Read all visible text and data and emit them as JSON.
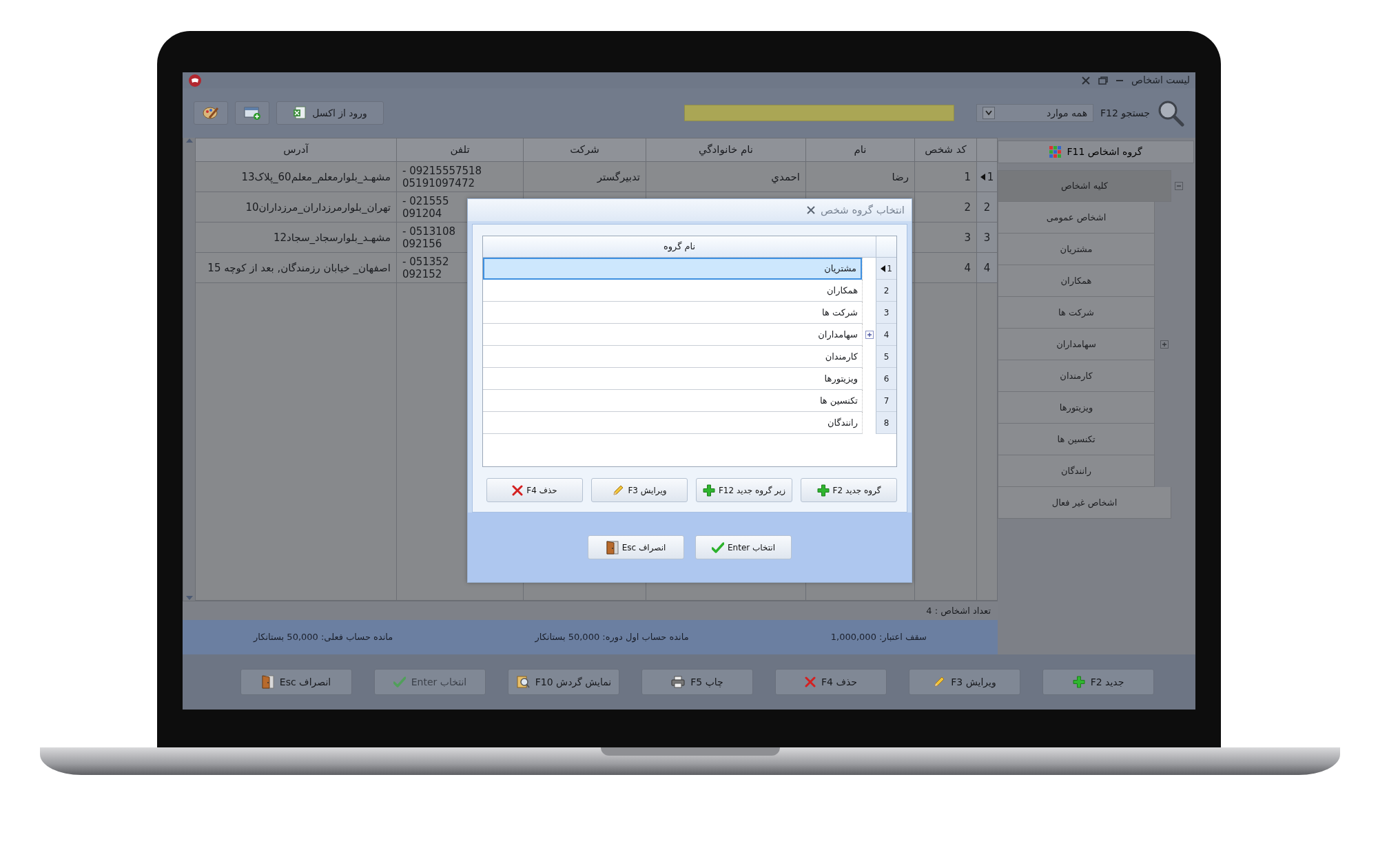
{
  "window": {
    "title": "لیست اشخاص"
  },
  "toolbar": {
    "import_button": "ورود از اکسل",
    "search_label": "جستجو F12",
    "search_scope": "همه موارد"
  },
  "table": {
    "columns": [
      "کد شخص",
      "نام",
      "نام خانوادگي",
      "شرکت",
      "تلفن",
      "آدرس"
    ],
    "rows": [
      {
        "indicator": "1",
        "selected": true,
        "cells": [
          "1",
          "رضا",
          "احمدي",
          "تدبیرگستر",
          "09215557518 -\n05191097472",
          "مشهـد_بلوارمعلم_معلم60_پلاک13"
        ]
      },
      {
        "indicator": "2",
        "selected": false,
        "cells": [
          "2",
          null,
          null,
          null,
          "021555 -\n091204",
          "تهران_بلوارمرزداران_مرزداران10"
        ]
      },
      {
        "indicator": "3",
        "selected": false,
        "cells": [
          "3",
          null,
          null,
          null,
          "0513108 -\n092156",
          "مشهـد_بلوارسجاد_سجاد12"
        ]
      },
      {
        "indicator": "4",
        "selected": false,
        "cells": [
          "4",
          null,
          null,
          null,
          "051352 -\n092152",
          "اصفهان_ خیابان رزمندگان, بعد از کوچه 15"
        ]
      }
    ]
  },
  "status": {
    "count": "تعداد اشخاص : 4"
  },
  "info_bar": [
    "سقف اعتبار: 1,000,000",
    "مانده حساب اول دوره: 50,000 بستانکار",
    "مانده حساب فعلی: 50,000 بستانکار"
  ],
  "sidebar": {
    "header": "گروه اشخاص F11",
    "items": [
      {
        "label": "کلیه اشخاص",
        "selected": true,
        "expanded": true,
        "children": [
          {
            "label": "اشخاص عمومی",
            "selected": false
          },
          {
            "label": "مشتریان",
            "selected": false
          },
          {
            "label": "همکاران",
            "selected": false
          },
          {
            "label": "شرکت ها",
            "selected": false
          },
          {
            "label": "سهامداران",
            "selected": false,
            "expanded": false
          },
          {
            "label": "کارمندان",
            "selected": false
          },
          {
            "label": "ویزیتورها",
            "selected": false
          },
          {
            "label": "تکنسین ها",
            "selected": false
          },
          {
            "label": "رانندگان",
            "selected": false
          }
        ]
      },
      {
        "label": "اشخاص غیر فعال",
        "selected": false
      }
    ]
  },
  "buttons": [
    {
      "label": "جدید F2",
      "kind": "add",
      "disabled": false
    },
    {
      "label": "ویرایش F3",
      "kind": "edit",
      "disabled": false
    },
    {
      "label": "حذف F4",
      "kind": "delete",
      "disabled": false
    },
    {
      "label": "چاپ F5",
      "kind": "print",
      "disabled": false
    },
    {
      "label": "نمایش گردش F10",
      "kind": "report",
      "disabled": false
    },
    {
      "label": "انتخاب Enter",
      "kind": "ok",
      "disabled": true
    },
    {
      "label": "انصراف Esc",
      "kind": "cancel",
      "disabled": false
    }
  ],
  "dialog": {
    "title": "انتخاب گروه شخص",
    "column": "نام گروه",
    "rows": [
      {
        "index": "1",
        "label": "مشتریان",
        "selected": true
      },
      {
        "index": "2",
        "label": "همکاران",
        "selected": false
      },
      {
        "index": "3",
        "label": "شرکت ها",
        "selected": false
      },
      {
        "index": "4",
        "label": "سهامداران",
        "selected": false,
        "expanded": false
      },
      {
        "index": "5",
        "label": "کارمندان",
        "selected": false
      },
      {
        "index": "6",
        "label": "ویزیتورها",
        "selected": false
      },
      {
        "index": "7",
        "label": "تکنسین ها",
        "selected": false
      },
      {
        "index": "8",
        "label": "رانندگان",
        "selected": false
      }
    ],
    "tool_buttons": [
      {
        "label": "گروه جدید F2",
        "kind": "add"
      },
      {
        "label": "زیر گروه جدید F12",
        "kind": "add"
      },
      {
        "label": "ویرایش F3",
        "kind": "edit"
      },
      {
        "label": "حذف F4",
        "kind": "delete"
      }
    ],
    "buttons": [
      {
        "label": "انتخاب Enter",
        "kind": "ok"
      },
      {
        "label": "انصراف Esc",
        "kind": "cancel"
      }
    ]
  }
}
